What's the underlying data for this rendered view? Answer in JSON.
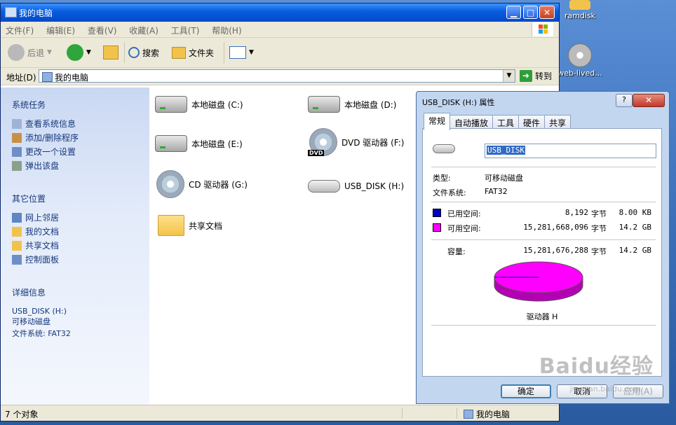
{
  "desktop": {
    "icons": [
      {
        "label": "ramdisk"
      },
      {
        "label": "web-lived..."
      }
    ]
  },
  "explorer": {
    "title": "我的电脑",
    "window_buttons": {
      "minimize": "▁",
      "maximize": "□",
      "close": "✕"
    },
    "menu": [
      "文件(F)",
      "编辑(E)",
      "查看(V)",
      "收藏(A)",
      "工具(T)",
      "帮助(H)"
    ],
    "toolbar": {
      "back": "后退",
      "search": "搜索",
      "folders": "文件夹"
    },
    "address": {
      "label": "地址(D)",
      "value": "我的电脑",
      "go": "转到"
    },
    "left_pane": {
      "system_tasks": {
        "title": "系统任务",
        "items": [
          "查看系统信息",
          "添加/删除程序",
          "更改一个设置",
          "弹出该盘"
        ]
      },
      "other_places": {
        "title": "其它位置",
        "items": [
          "网上邻居",
          "我的文档",
          "共享文档",
          "控制面板"
        ]
      },
      "details": {
        "title": "详细信息",
        "name": "USB_DISK (H:)",
        "type": "可移动磁盘",
        "fs": "文件系统: FAT32"
      }
    },
    "items": [
      {
        "label": "本地磁盘 (C:)",
        "kind": "hdd"
      },
      {
        "label": "本地磁盘 (D:)",
        "kind": "hdd"
      },
      {
        "label": "本地磁盘 (E:)",
        "kind": "hdd"
      },
      {
        "label": "DVD 驱动器 (F:)",
        "kind": "dvd"
      },
      {
        "label": "CD 驱动器 (G:)",
        "kind": "cd"
      },
      {
        "label": "USB_DISK (H:)",
        "kind": "usb"
      },
      {
        "label": "共享文档",
        "kind": "folder"
      }
    ],
    "dvd_badge": "DVD",
    "status": {
      "count": "7 个对象",
      "location": "我的电脑"
    }
  },
  "dialog": {
    "title": "USB_DISK (H:) 属性",
    "help": "?",
    "close": "✕",
    "tabs": [
      "常规",
      "自动播放",
      "工具",
      "硬件",
      "共享"
    ],
    "name_value": "USB_DISK",
    "type_label": "类型:",
    "type_value": "可移动磁盘",
    "fs_label": "文件系统:",
    "fs_value": "FAT32",
    "used": {
      "label": "已用空间:",
      "bytes": "8,192",
      "unit": "字节",
      "size": "8.00 KB",
      "color": "#0000cc"
    },
    "free": {
      "label": "可用空间:",
      "bytes": "15,281,668,096",
      "unit": "字节",
      "size": "14.2 GB",
      "color": "#ff00ff"
    },
    "capacity": {
      "label": "容量:",
      "bytes": "15,281,676,288",
      "unit": "字节",
      "size": "14.2 GB"
    },
    "drive_label": "驱动器 H",
    "used_fraction": 5e-07,
    "buttons": {
      "ok": "确定",
      "cancel": "取消",
      "apply": "应用(A)"
    }
  },
  "watermark": {
    "main": "Baidu经验",
    "sub": "jingyan.baidu.com"
  }
}
